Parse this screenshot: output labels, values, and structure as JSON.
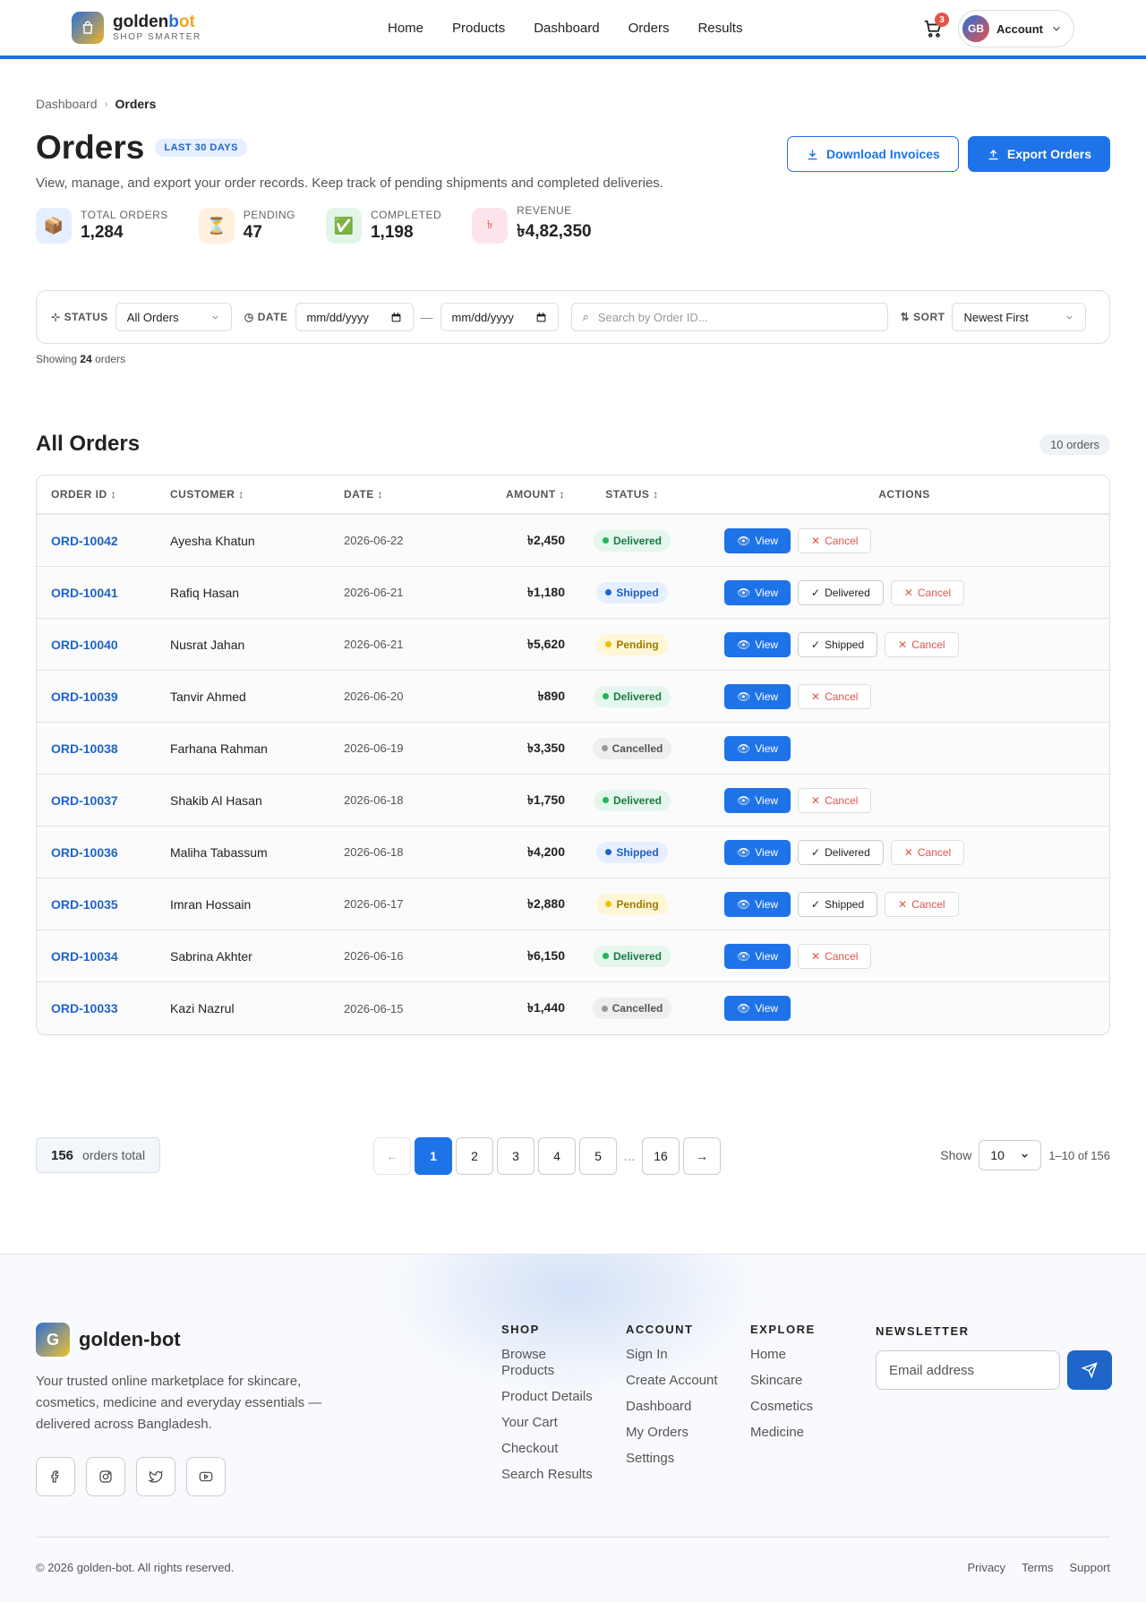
{
  "header": {
    "brand_part1": "golden",
    "brand_part2": "b",
    "brand_part3": "ot",
    "tagline": "SHOP SMARTER",
    "nav": [
      "Home",
      "Products",
      "Dashboard",
      "Orders",
      "Results"
    ],
    "cart_count": "3",
    "avatar_initials": "GB",
    "account_label": "Account"
  },
  "breadcrumb": {
    "parent": "Dashboard",
    "separator": "›",
    "current": "Orders"
  },
  "page": {
    "title": "Orders",
    "period_badge": "LAST 30 DAYS",
    "subtitle": "View, manage, and export your order records. Keep track of pending shipments and completed deliveries.",
    "download_label": "Download Invoices",
    "export_label": "Export Orders"
  },
  "stats": [
    {
      "label": "TOTAL ORDERS",
      "value": "1,284",
      "icon": "📦",
      "bg": "#e6efff"
    },
    {
      "label": "PENDING",
      "value": "47",
      "icon": "⏳",
      "bg": "#fff1dd"
    },
    {
      "label": "COMPLETED",
      "value": "1,198",
      "icon": "✅",
      "bg": "#e3f5e9"
    },
    {
      "label": "REVENUE",
      "value": "৳4,82,350",
      "icon": "৳",
      "bg": "#fde4ea"
    }
  ],
  "filters": {
    "status_label": "STATUS",
    "status_value": "All Orders",
    "date_label": "DATE",
    "date_from": "mm/dd/yyyy",
    "date_sep": "—",
    "date_to": "mm/dd/yyyy",
    "search_placeholder": "Search by Order ID...",
    "sort_label": "SORT",
    "sort_value": "Newest First"
  },
  "showing": {
    "prefix": "Showing",
    "count": "24",
    "suffix": "orders"
  },
  "orders_section": {
    "title": "All Orders",
    "count_badge": "10 orders"
  },
  "table": {
    "headers": [
      "ORDER ID ↕",
      "CUSTOMER ↕",
      "DATE ↕",
      "AMOUNT ↕",
      "STATUS ↕",
      "ACTIONS"
    ],
    "rows": [
      {
        "id": "ORD-10042",
        "customer": "Ayesha Khatun",
        "date": "2026-06-22",
        "amount": "৳2,450",
        "status": "Delivered"
      },
      {
        "id": "ORD-10041",
        "customer": "Rafiq Hasan",
        "date": "2026-06-21",
        "amount": "৳1,180",
        "status": "Shipped"
      },
      {
        "id": "ORD-10040",
        "customer": "Nusrat Jahan",
        "date": "2026-06-21",
        "amount": "৳5,620",
        "status": "Pending"
      },
      {
        "id": "ORD-10039",
        "customer": "Tanvir Ahmed",
        "date": "2026-06-20",
        "amount": "৳890",
        "status": "Delivered"
      },
      {
        "id": "ORD-10038",
        "customer": "Farhana Rahman",
        "date": "2026-06-19",
        "amount": "৳3,350",
        "status": "Cancelled"
      },
      {
        "id": "ORD-10037",
        "customer": "Shakib Al Hasan",
        "date": "2026-06-18",
        "amount": "৳1,750",
        "status": "Delivered"
      },
      {
        "id": "ORD-10036",
        "customer": "Maliha Tabassum",
        "date": "2026-06-18",
        "amount": "৳4,200",
        "status": "Shipped"
      },
      {
        "id": "ORD-10035",
        "customer": "Imran Hossain",
        "date": "2026-06-17",
        "amount": "৳2,880",
        "status": "Pending"
      },
      {
        "id": "ORD-10034",
        "customer": "Sabrina Akhter",
        "date": "2026-06-16",
        "amount": "৳6,150",
        "status": "Delivered"
      },
      {
        "id": "ORD-10033",
        "customer": "Kazi Nazrul",
        "date": "2026-06-15",
        "amount": "৳1,440",
        "status": "Cancelled"
      }
    ],
    "actions": {
      "view": "View",
      "delivered": "Delivered",
      "shipped": "Shipped",
      "cancel": "Cancel"
    }
  },
  "pagination": {
    "total_count": "156",
    "total_label": "orders total",
    "prev": "←",
    "pages": [
      "1",
      "2",
      "3",
      "4",
      "5"
    ],
    "ellipsis": "…",
    "last": "16",
    "next": "→",
    "show_label": "Show",
    "page_size": "10",
    "range": "1–10 of 156"
  },
  "footer": {
    "logo_letter": "G",
    "brand": "golden-bot",
    "description": "Your trusted online marketplace for skincare, cosmetics, medicine and everyday essentials — delivered across Bangladesh.",
    "columns": [
      {
        "title": "SHOP",
        "links": [
          "Browse Products",
          "Product Details",
          "Your Cart",
          "Checkout",
          "Search Results"
        ]
      },
      {
        "title": "ACCOUNT",
        "links": [
          "Sign In",
          "Create Account",
          "Dashboard",
          "My Orders",
          "Settings"
        ]
      },
      {
        "title": "EXPLORE",
        "links": [
          "Home",
          "Skincare",
          "Cosmetics",
          "Medicine"
        ]
      }
    ],
    "newsletter_title": "NEWSLETTER",
    "newsletter_placeholder": "Email address",
    "copyright": "© 2026 golden-bot. All rights reserved.",
    "bottom_links": [
      "Privacy",
      "Terms",
      "Support"
    ]
  },
  "colors": {
    "accent": "#1f73e8",
    "delivered": "#22b45a",
    "shipped": "#1f64c8",
    "pending": "#f0c000",
    "cancelled": "#999999",
    "danger": "#e5534b"
  }
}
